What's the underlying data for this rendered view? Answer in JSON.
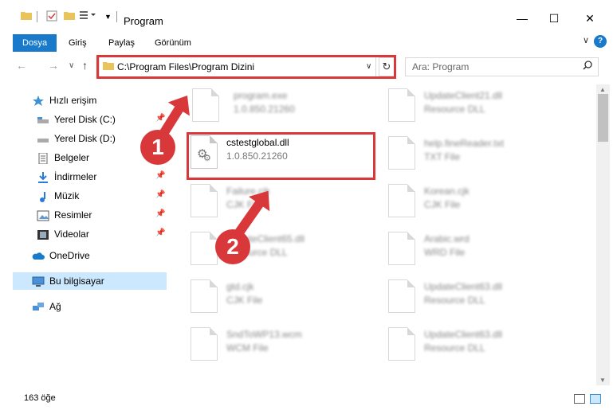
{
  "window": {
    "title": "Program",
    "minimize": "—",
    "maximize": "☐",
    "close": "✕"
  },
  "ribbon": {
    "tabs": [
      "Dosya",
      "Giriş",
      "Paylaş",
      "Görünüm"
    ],
    "help": "?",
    "collapse": "∨"
  },
  "address": {
    "path": "C:\\Program Files\\Program Dizini",
    "dropdown": "∨",
    "refresh": "↻",
    "search_placeholder": "Ara: Program",
    "back": "←",
    "forward": "→",
    "recent": "∨",
    "up": "↑"
  },
  "sidebar": {
    "quick_access": "Hızlı erişim",
    "items": [
      {
        "label": "Yerel Disk (C:)",
        "icon": "drive-icon",
        "pinned": true
      },
      {
        "label": "Yerel Disk (D:)",
        "icon": "drive-icon",
        "pinned": false
      },
      {
        "label": "Belgeler",
        "icon": "documents-icon",
        "pinned": true
      },
      {
        "label": "İndirmeler",
        "icon": "download-icon",
        "pinned": true
      },
      {
        "label": "Müzik",
        "icon": "music-icon",
        "pinned": true
      },
      {
        "label": "Resimler",
        "icon": "pictures-icon",
        "pinned": true
      },
      {
        "label": "Videolar",
        "icon": "videos-icon",
        "pinned": true
      }
    ],
    "onedrive": "OneDrive",
    "this_pc": "Bu bilgisayar",
    "network": "Ağ"
  },
  "files": {
    "highlighted": {
      "name": "cstestglobal.dll",
      "version": "1.0.850.21260"
    },
    "col1": [
      {
        "name": "program.exe",
        "desc": "1.0.850.21260"
      },
      {
        "name": "Failure.cjk",
        "desc": "CJK File"
      },
      {
        "name": "UpdateClient65.dll",
        "desc": "Resource DLL"
      },
      {
        "name": "gtd.cjk",
        "desc": "CJK File"
      },
      {
        "name": "SndToWP13.wcm",
        "desc": "WCM File"
      }
    ],
    "col2": [
      {
        "name": "UpdateClient21.dll",
        "desc": "Resource DLL"
      },
      {
        "name": "help.fineReader.txt",
        "desc": "TXT File"
      },
      {
        "name": "Korean.cjk",
        "desc": "CJK File"
      },
      {
        "name": "Arabic.wrd",
        "desc": "WRD File"
      },
      {
        "name": "UpdateClient63.dll",
        "desc": "Resource DLL"
      },
      {
        "name": "UpdateClient63.dll",
        "desc": "Resource DLL"
      }
    ]
  },
  "callouts": [
    "1",
    "2"
  ],
  "status": {
    "count": "163 öğe"
  },
  "colors": {
    "accent": "#1979ca",
    "highlight": "#d9383a",
    "selected": "#cce8ff"
  }
}
